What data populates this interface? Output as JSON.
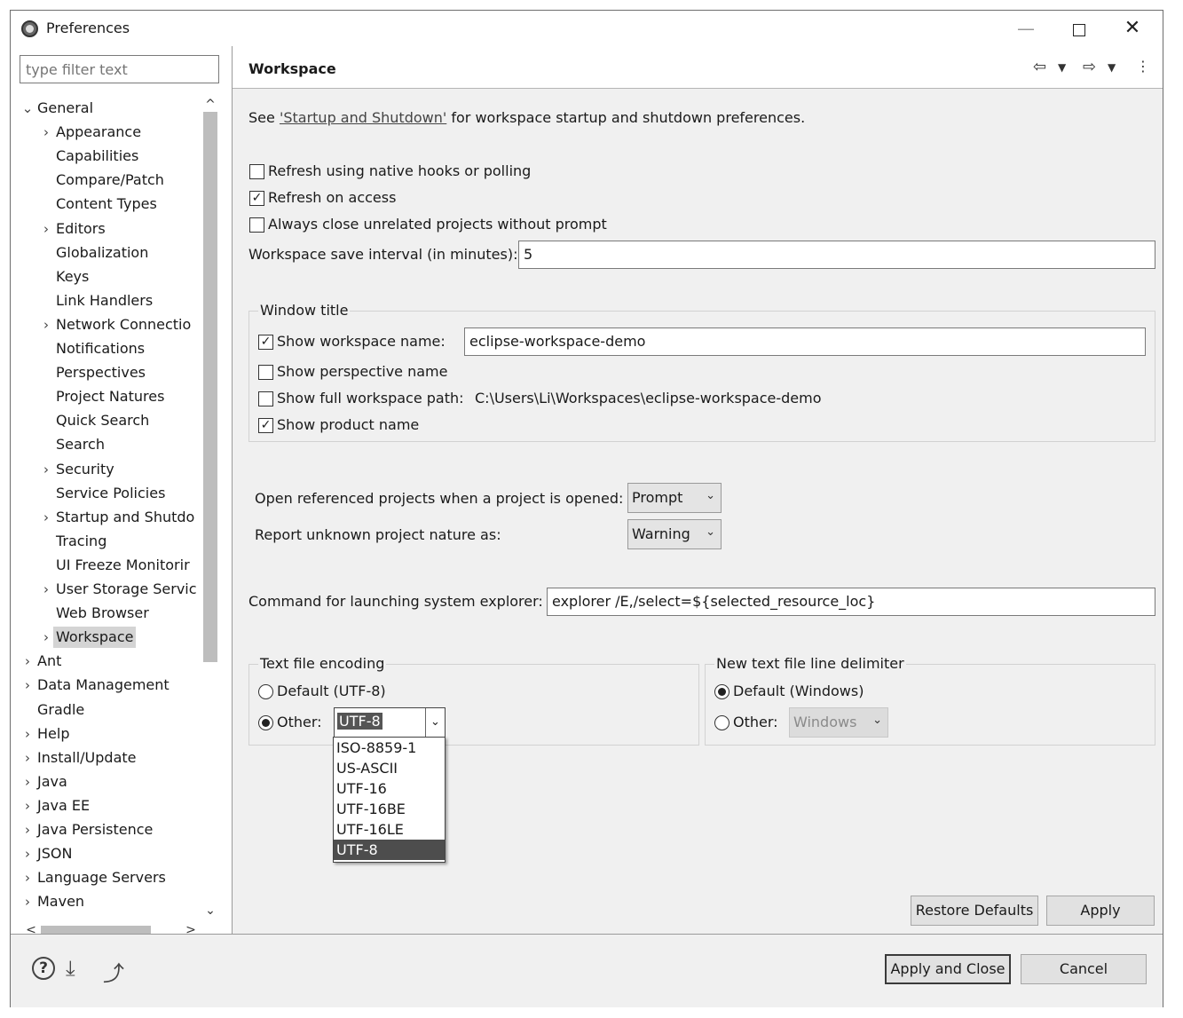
{
  "window": {
    "title": "Preferences",
    "minimize": "—",
    "close": "✕"
  },
  "filter": {
    "placeholder": "type filter text"
  },
  "tree": [
    {
      "label": "General",
      "arrow": "⌄",
      "indent": 0
    },
    {
      "label": "Appearance",
      "arrow": "›",
      "indent": 1
    },
    {
      "label": "Capabilities",
      "arrow": "",
      "indent": 1
    },
    {
      "label": "Compare/Patch",
      "arrow": "",
      "indent": 1
    },
    {
      "label": "Content Types",
      "arrow": "",
      "indent": 1
    },
    {
      "label": "Editors",
      "arrow": "›",
      "indent": 1
    },
    {
      "label": "Globalization",
      "arrow": "",
      "indent": 1
    },
    {
      "label": "Keys",
      "arrow": "",
      "indent": 1
    },
    {
      "label": "Link Handlers",
      "arrow": "",
      "indent": 1
    },
    {
      "label": "Network Connectio",
      "arrow": "›",
      "indent": 1
    },
    {
      "label": "Notifications",
      "arrow": "",
      "indent": 1
    },
    {
      "label": "Perspectives",
      "arrow": "",
      "indent": 1
    },
    {
      "label": "Project Natures",
      "arrow": "",
      "indent": 1
    },
    {
      "label": "Quick Search",
      "arrow": "",
      "indent": 1
    },
    {
      "label": "Search",
      "arrow": "",
      "indent": 1
    },
    {
      "label": "Security",
      "arrow": "›",
      "indent": 1
    },
    {
      "label": "Service Policies",
      "arrow": "",
      "indent": 1
    },
    {
      "label": "Startup and Shutdo",
      "arrow": "›",
      "indent": 1
    },
    {
      "label": "Tracing",
      "arrow": "",
      "indent": 1
    },
    {
      "label": "UI Freeze Monitorir",
      "arrow": "",
      "indent": 1
    },
    {
      "label": "User Storage Servic",
      "arrow": "›",
      "indent": 1
    },
    {
      "label": "Web Browser",
      "arrow": "",
      "indent": 1
    },
    {
      "label": "Workspace",
      "arrow": "›",
      "indent": 1,
      "selected": true
    },
    {
      "label": "Ant",
      "arrow": "›",
      "indent": 0
    },
    {
      "label": "Data Management",
      "arrow": "›",
      "indent": 0
    },
    {
      "label": "Gradle",
      "arrow": "",
      "indent": 0
    },
    {
      "label": "Help",
      "arrow": "›",
      "indent": 0
    },
    {
      "label": "Install/Update",
      "arrow": "›",
      "indent": 0
    },
    {
      "label": "Java",
      "arrow": "›",
      "indent": 0
    },
    {
      "label": "Java EE",
      "arrow": "›",
      "indent": 0
    },
    {
      "label": "Java Persistence",
      "arrow": "›",
      "indent": 0
    },
    {
      "label": "JSON",
      "arrow": "›",
      "indent": 0
    },
    {
      "label": "Language Servers",
      "arrow": "›",
      "indent": 0
    },
    {
      "label": "Maven",
      "arrow": "›",
      "indent": 0
    }
  ],
  "page": {
    "title": "Workspace",
    "see_prefix": "See ",
    "see_link": "'Startup and Shutdown'",
    "see_suffix": " for workspace startup and shutdown preferences.",
    "refresh_native": {
      "label": "Refresh using native hooks or polling",
      "checked": false
    },
    "refresh_access": {
      "label": "Refresh on access",
      "checked": true
    },
    "always_close": {
      "label": "Always close unrelated projects without prompt",
      "checked": false
    },
    "save_interval_label": "Workspace save interval (in minutes):",
    "save_interval_value": "5",
    "window_title": {
      "legend": "Window title",
      "show_workspace_name": {
        "label": "Show workspace name:",
        "checked": true,
        "value": "eclipse-workspace-demo"
      },
      "show_perspective_name": {
        "label": "Show perspective name",
        "checked": false
      },
      "show_full_path": {
        "label": "Show full workspace path:",
        "checked": false,
        "value": "C:\\Users\\Li\\Workspaces\\eclipse-workspace-demo"
      },
      "show_product_name": {
        "label": "Show product name",
        "checked": true
      }
    },
    "open_referenced_label": "Open referenced projects when a project is opened:",
    "open_referenced_value": "Prompt",
    "report_unknown_label": "Report unknown project nature as:",
    "report_unknown_value": "Warning",
    "command_label": "Command for launching system explorer:",
    "command_value": "explorer /E,/select=${selected_resource_loc}",
    "encoding": {
      "legend": "Text file encoding",
      "default_label": "Default (UTF-8)",
      "other_label": "Other:",
      "other_value": "UTF-8",
      "options": [
        "ISO-8859-1",
        "US-ASCII",
        "UTF-16",
        "UTF-16BE",
        "UTF-16LE",
        "UTF-8"
      ],
      "highlighted": "UTF-8"
    },
    "delimiter": {
      "legend": "New text file line delimiter",
      "default_label": "Default (Windows)",
      "other_label": "Other:",
      "other_value": "Windows"
    },
    "restore_defaults": "Restore Defaults",
    "apply": "Apply"
  },
  "footer": {
    "help": "?",
    "apply_close": "Apply and Close",
    "cancel": "Cancel"
  },
  "icons": [
    "app-icon",
    "help-icon",
    "import-icon",
    "export-icon",
    "back-icon",
    "forward-icon",
    "view-menu-icon"
  ]
}
